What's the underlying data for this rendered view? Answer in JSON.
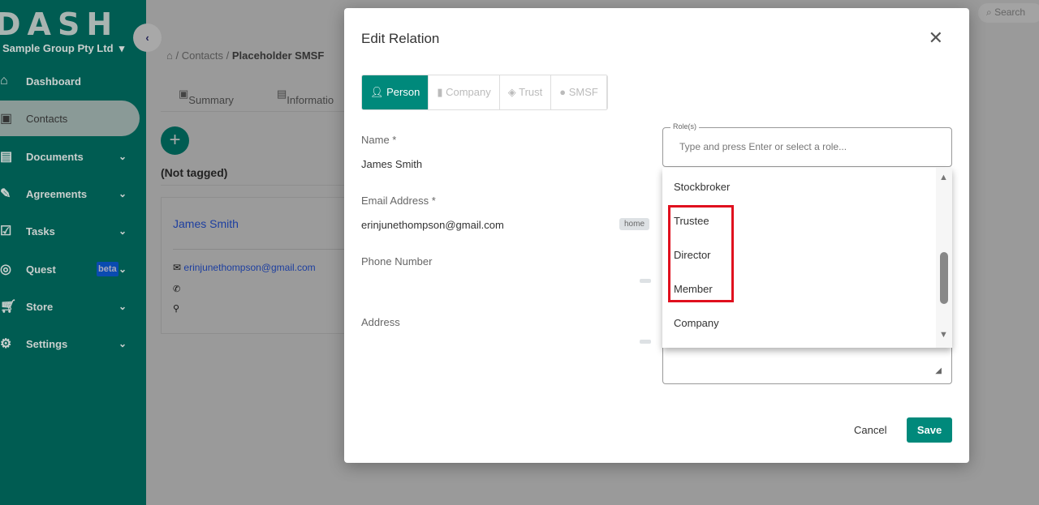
{
  "sidebar": {
    "logo": "DASH",
    "org": "Sample Group Pty Ltd",
    "items": [
      {
        "label": "Dashboard",
        "icon": "home-icon"
      },
      {
        "label": "Contacts",
        "icon": "contacts-icon"
      },
      {
        "label": "Documents",
        "icon": "documents-icon"
      },
      {
        "label": "Agreements",
        "icon": "pen-icon"
      },
      {
        "label": "Tasks",
        "icon": "tasks-icon"
      },
      {
        "label": "Quest",
        "icon": "compass-icon",
        "badge": "beta"
      },
      {
        "label": "Store",
        "icon": "cart-icon"
      },
      {
        "label": "Settings",
        "icon": "gear-icon"
      }
    ]
  },
  "header": {
    "search": "Search",
    "breadcrumb": [
      "Contacts",
      "Placeholder SMSF"
    ]
  },
  "page": {
    "tabs": [
      "Summary",
      "Informatio"
    ],
    "group": "(Not tagged)",
    "card": {
      "name": "James Smith",
      "email": "erinjunethompson@gmail.com"
    }
  },
  "modal": {
    "title": "Edit Relation",
    "types": [
      "Person",
      "Company",
      "Trust",
      "SMSF"
    ],
    "name_label": "Name *",
    "name": "James Smith",
    "email_label": "Email Address *",
    "email": "erinjunethompson@gmail.com",
    "email_tag": "home",
    "phone_label": "Phone Number",
    "address_label": "Address",
    "roles_label": "Role(s)",
    "roles_placeholder": "Type and press Enter or select a role...",
    "options": [
      "Stockbroker",
      "Trustee",
      "Director",
      "Member",
      "Company"
    ],
    "cancel": "Cancel",
    "save": "Save"
  },
  "colors": {
    "accent": "#00897b",
    "highlight": "#e0101e"
  }
}
